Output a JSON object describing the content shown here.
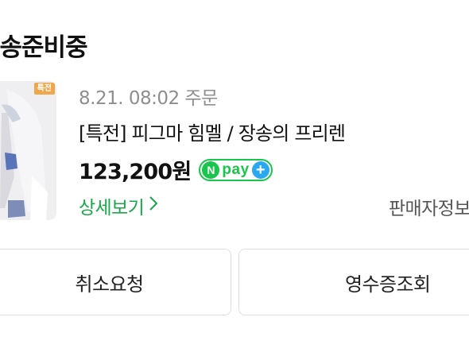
{
  "header": {
    "status_title": "배송준비중"
  },
  "order": {
    "thumbnail": {
      "badge": "특전",
      "alt": "product-thumbnail"
    },
    "order_date": "8.21. 08:02 주문",
    "product_name": "[특전] 피그마 힘멜 / 장송의 프리렌",
    "price": "123,200원",
    "payment_badge": {
      "letter": "N",
      "word": "pay",
      "plus": "+",
      "icon": "npay-plus-icon",
      "colors": {
        "green": "#19c54a",
        "blue": "#2aa8f0"
      }
    },
    "detail_link": "상세보기",
    "seller_link": "판매자정보"
  },
  "actions": {
    "cancel_label": "취소요청",
    "receipt_label": "영수증조회"
  },
  "colors": {
    "accent_green": "#18a84a",
    "badge_orange": "#f0a64a",
    "text_primary": "#111111",
    "text_muted": "#8e8e8e",
    "border": "#dedede"
  }
}
